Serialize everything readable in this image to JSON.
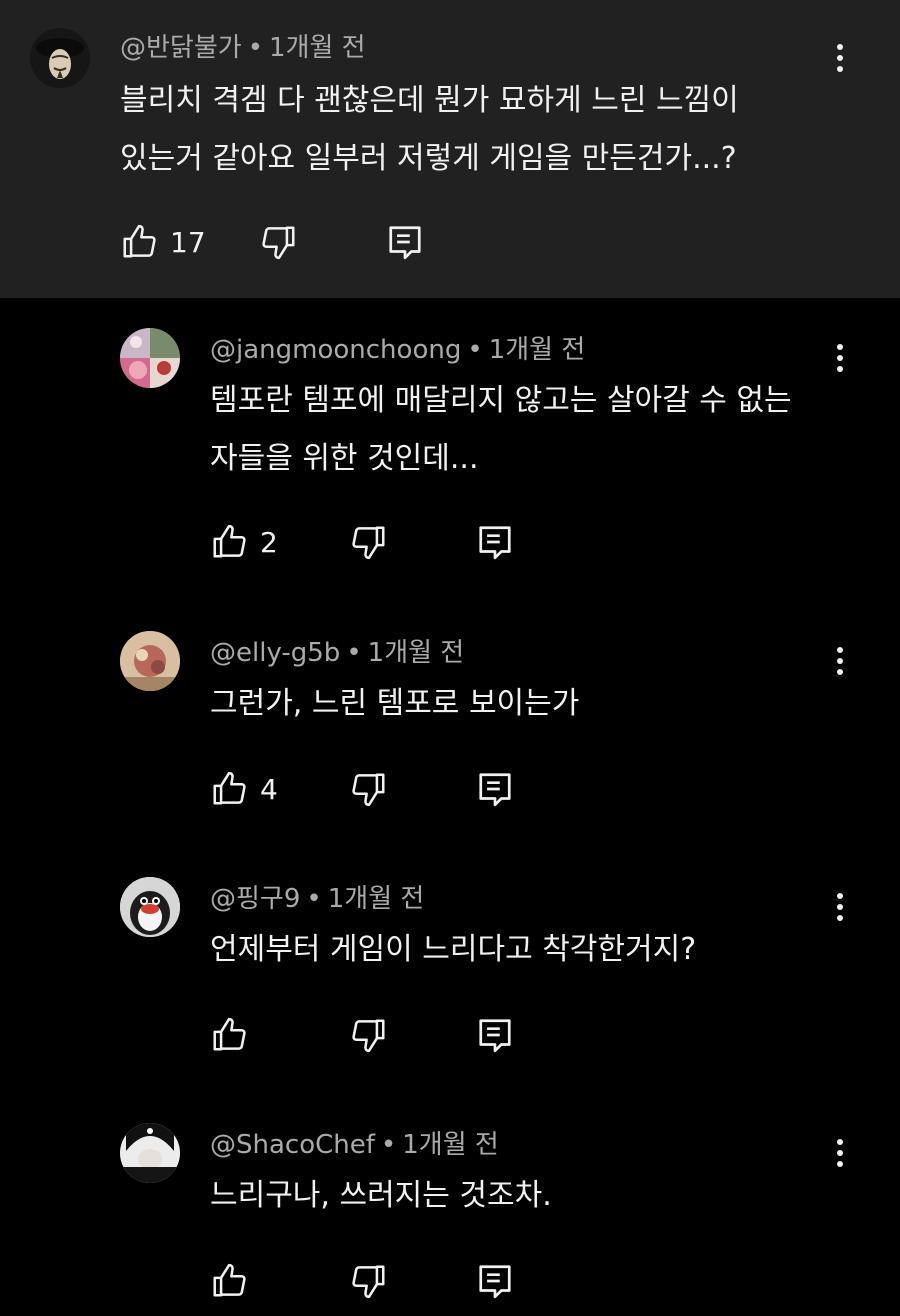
{
  "comments": [
    {
      "user": "@반닭불가",
      "time": "1개월 전",
      "lines": [
        "블리치 격겜 다 괜찮은데 뭔가 묘하게 느린 느낌이",
        "있는거 같아요 일부러 저렇게 게임을 만든건가...?"
      ],
      "likes": "17"
    },
    {
      "user": "@jangmoonchoong",
      "time": "1개월 전",
      "lines": [
        "템포란 템포에 매달리지 않고는 살아갈 수 없는",
        "자들을 위한 것인데..."
      ],
      "likes": "2"
    },
    {
      "user": "@elly-g5b",
      "time": "1개월 전",
      "lines": [
        "그런가,  느린 템포로 보이는가"
      ],
      "likes": "4"
    },
    {
      "user": "@핑구9",
      "time": "1개월 전",
      "lines": [
        "언제부터 게임이 느리다고 착각한거지?"
      ],
      "likes": ""
    },
    {
      "user": "@ShacoChef",
      "time": "1개월 전",
      "lines": [
        "느리구나, 쓰러지는 것조차."
      ],
      "likes": ""
    }
  ],
  "colors": {
    "parent_bg": "#212121",
    "page_bg": "#000000",
    "meta": "#aaaaaa",
    "text": "#f1f1f1"
  },
  "icons": [
    "more-vert-icon",
    "thumb-up-icon",
    "thumb-down-icon",
    "reply-icon"
  ]
}
